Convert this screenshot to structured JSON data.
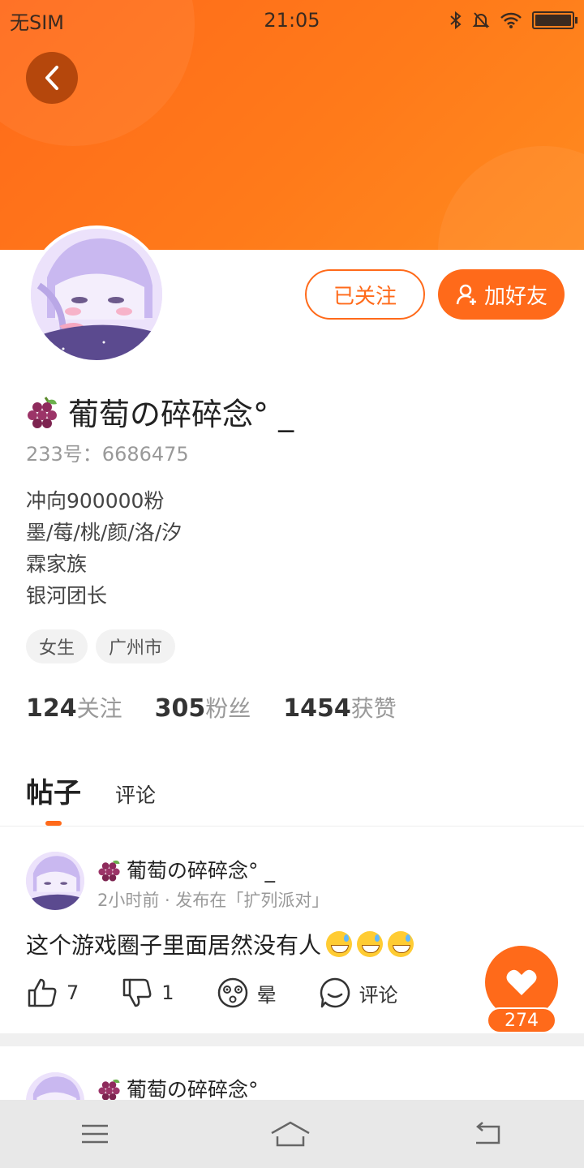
{
  "status_bar": {
    "carrier": "无SIM",
    "time": "21:05"
  },
  "profile": {
    "name": "葡萄の碎碎念° _",
    "user_id": "233号：6686475",
    "bio_lines": [
      "冲向900000粉",
      "墨/莓/桃/颜/洛/汐",
      "霖家族",
      "银河团长"
    ],
    "tags": [
      "女生",
      "广州市"
    ],
    "follow_label": "已关注",
    "add_friend_label": "加好友"
  },
  "stats": {
    "following_count": "124",
    "following_label": "关注",
    "fans_count": "305",
    "fans_label": "粉丝",
    "likes_count": "1454",
    "likes_label": "获赞"
  },
  "tabs": {
    "posts": "帖子",
    "comments": "评论"
  },
  "posts": [
    {
      "author": "葡萄の碎碎念° _",
      "meta": "2小时前 · 发布在「扩列派对」",
      "text": "这个游戏圈子里面居然没有人",
      "likes": "7",
      "dislikes": "1",
      "dizzy_label": "晕",
      "comment_label": "评论"
    },
    {
      "author": "葡萄の碎碎念° _"
    }
  ],
  "like_fab": {
    "count": "274"
  },
  "colors": {
    "accent": "#ff6a1a",
    "banner": "#ff7a1a"
  },
  "icons": [
    "back-arrow-icon",
    "bluetooth-icon",
    "mute-bell-icon",
    "wifi-icon",
    "battery-icon",
    "add-user-icon",
    "grape-icon",
    "thumb-up-icon",
    "thumb-down-icon",
    "dizzy-face-icon",
    "comment-icon",
    "heart-icon",
    "menu-icon",
    "home-icon",
    "return-icon"
  ]
}
